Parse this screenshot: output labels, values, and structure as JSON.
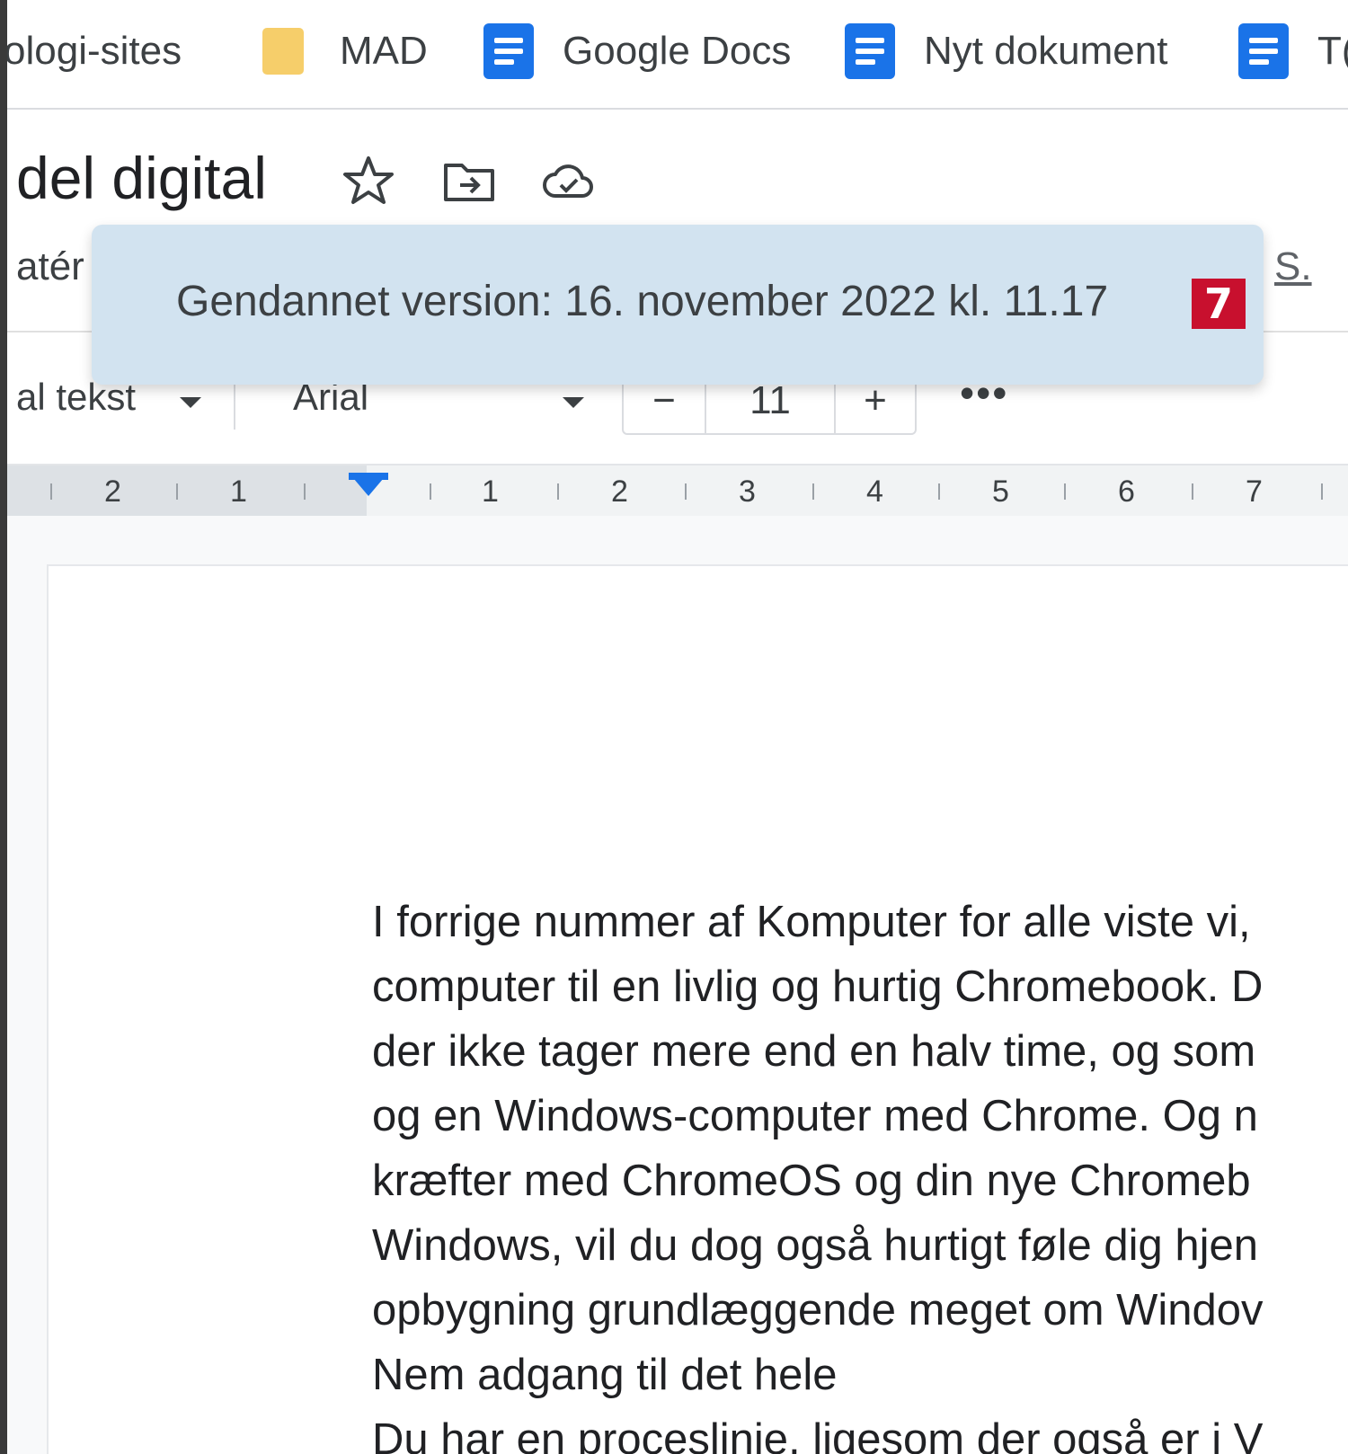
{
  "bookmarks": {
    "items": [
      {
        "label": "ologi-sites",
        "icon": "none"
      },
      {
        "label": "MAD",
        "icon": "folder-icon"
      },
      {
        "label": "Google Docs",
        "icon": "docs-icon"
      },
      {
        "label": "Nyt dokument",
        "icon": "docs-icon"
      },
      {
        "label": "T(",
        "icon": "docs-icon"
      }
    ]
  },
  "document": {
    "title_fragment": "del digital"
  },
  "menu": {
    "left_fragment": "atér",
    "right_fragment": "S."
  },
  "toolbar": {
    "style_fragment": "al tekst",
    "font": "Arial",
    "font_size": "11",
    "minus": "−",
    "plus": "+",
    "more": "•••"
  },
  "ruler": {
    "labels": [
      "2",
      "1",
      "1",
      "2",
      "3",
      "4",
      "5",
      "6",
      "7"
    ]
  },
  "toast": {
    "message": "Gendannet version: 16. november 2022 kl. 11.17",
    "badge": "7"
  },
  "body_text": {
    "lines": [
      "I forrige nummer af Komputer for alle viste vi,",
      "computer til en livlig og hurtig Chromebook. D",
      "der ikke tager mere end en halv time, og som",
      "og en Windows-computer med Chrome. Og n",
      "kræfter med ChromeOS og din nye Chromeb",
      "Windows, vil du dog også hurtigt føle dig hjen",
      "opbygning grundlæggende meget om Windov",
      "Nem adgang til det hele",
      "Du har en proceslinie, ligesom der også er i V"
    ]
  },
  "colors": {
    "accent": "#1a73e8",
    "toast_bg": "#d2e3f0",
    "badge_bg": "#c8102e",
    "folder": "#f6ce6a"
  }
}
